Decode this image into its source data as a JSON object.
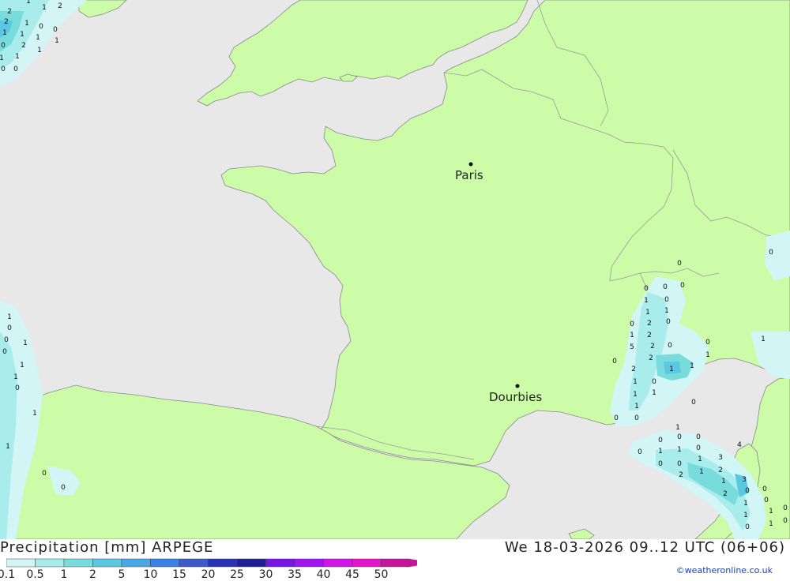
{
  "map": {
    "cities": [
      {
        "name": "Paris"
      },
      {
        "name": "Dourbies"
      }
    ],
    "rain_values_west": [
      "2",
      "1",
      "1",
      "2",
      "1",
      "0",
      "2",
      "1",
      "1",
      "0",
      "1",
      "2",
      "1",
      "1",
      "0",
      "1",
      "1",
      "0",
      "0",
      "1",
      "0",
      "0",
      "1",
      "0",
      "1",
      "1",
      "0",
      "1",
      "1",
      "0",
      "0"
    ],
    "rain_values_alps": [
      "0",
      "0",
      "0",
      "0",
      "1",
      "0",
      "1",
      "1",
      "2",
      "0",
      "2",
      "2",
      "0",
      "0",
      "1",
      "5",
      "2",
      "1",
      "1",
      "2",
      "1",
      "1",
      "1",
      "0",
      "1",
      "0",
      "0",
      "0",
      "0",
      "1",
      "0",
      "1",
      "0",
      "0",
      "0",
      "0",
      "1",
      "1",
      "0",
      "0",
      "0",
      "2",
      "1",
      "1",
      "3",
      "2",
      "4",
      "1",
      "3",
      "2",
      "0",
      "1",
      "1",
      "0",
      "0",
      "0",
      "1",
      "1",
      "0",
      "0",
      "1",
      "0"
    ]
  },
  "legend": {
    "title": "Precipitation [mm] ARPEGE",
    "scale_labels": [
      "0.1",
      "0.5",
      "1",
      "2",
      "5",
      "10",
      "15",
      "20",
      "25",
      "30",
      "35",
      "40",
      "45",
      "50"
    ],
    "scale_colors": [
      "#d2f5f5",
      "#a8ecec",
      "#78dcdc",
      "#5ac8e0",
      "#4aa6e6",
      "#3c82e6",
      "#3c5ac8",
      "#2832b4",
      "#1e1e96",
      "#7814e6",
      "#a014f0",
      "#d214e6",
      "#e614c8",
      "#c8149b"
    ]
  },
  "timestamp": "We 18-03-2026 09..12 UTC (06+06)",
  "copyright": "©weatheronline.co.uk"
}
